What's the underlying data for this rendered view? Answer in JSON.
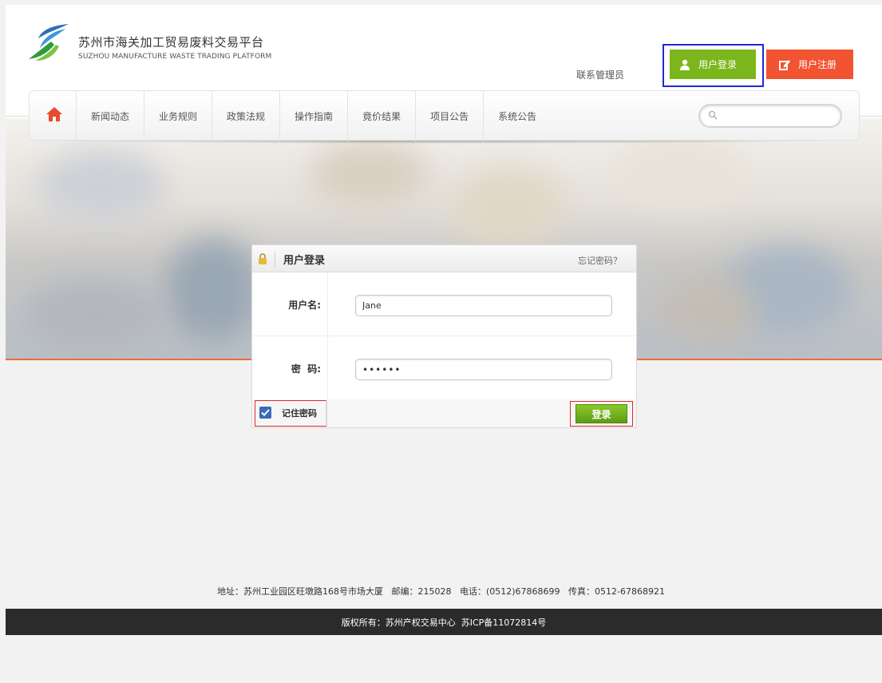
{
  "header": {
    "logo_title": "苏州市海关加工贸易废料交易平台",
    "logo_subtitle": "SUZHOU MANUFACTURE WASTE TRADING PLATFORM",
    "contact_label": "联系管理员",
    "login_button_label": "用户登录",
    "register_button_label": "用户注册",
    "login_icon": "user-icon",
    "register_icon": "edit-icon"
  },
  "nav": {
    "home_icon": "home-icon",
    "items": [
      "新闻动态",
      "业务规则",
      "政策法规",
      "操作指南",
      "竟价结果",
      "项目公告",
      "系统公告"
    ],
    "search_placeholder": ""
  },
  "login_panel": {
    "title": "用户登录",
    "forgot_label": "忘记密码？",
    "username_label": "用户名:",
    "username_value": "Jane",
    "password_label": "密  码:",
    "password_value": "••••••",
    "remember_label": "记住密码",
    "remember_checked": true,
    "submit_label": "登录"
  },
  "footer": {
    "address": "地址：苏州工业园区旺墩路168号市场大厦   邮编：215028   电话：(0512)67868699   传真：0512-67868921",
    "copyright": "版权所有：苏州产权交易中心  苏ICP备11072814号"
  },
  "colors": {
    "login_green": "#7bb61c",
    "register_red": "#f25330",
    "highlight_blue": "#1d2ad6",
    "accent_orange": "#f26a36",
    "footer_dark": "#2b2b2b"
  }
}
